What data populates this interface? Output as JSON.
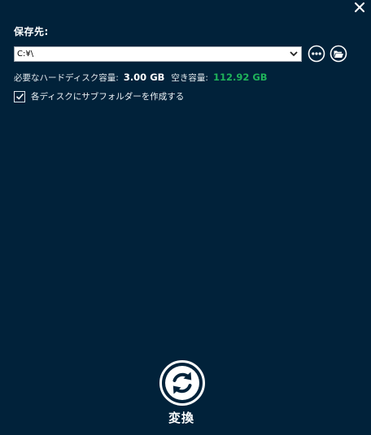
{
  "dialog": {
    "save_to_label": "保存先:",
    "close_icon": "close-icon"
  },
  "destination": {
    "path_value": "C:¥\\",
    "dropdown_icon": "chevron-down-icon",
    "browse_icon": "more-options-icon",
    "open_folder_icon": "open-folder-icon"
  },
  "disk": {
    "required_label": "必要なハードディスク容量:",
    "required_value": "3.00 GB",
    "free_label": "空き容量:",
    "free_value": "112.92 GB",
    "free_color": "#1fb35a"
  },
  "options": {
    "subfolder_label": "各ディスクにサブフォルダーを作成する",
    "subfolder_checked": true
  },
  "action": {
    "convert_label": "変換",
    "convert_icon": "convert-refresh-icon"
  },
  "colors": {
    "background": "#01223a",
    "accent_green": "#1fb35a"
  }
}
